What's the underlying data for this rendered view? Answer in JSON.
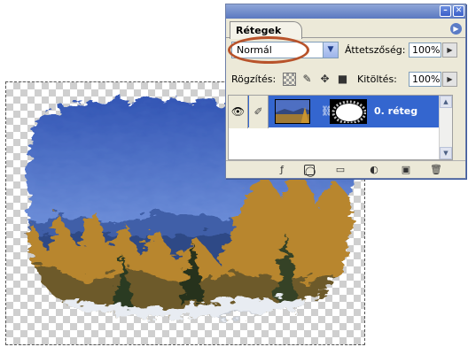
{
  "layers_panel": {
    "tab_label": "Rétegek",
    "blend_mode": "Normál",
    "opacity_label": "Áttetszőség:",
    "opacity_value": "100%",
    "lock_label": "Rögzítés:",
    "fill_label": "Kitöltés:",
    "fill_value": "100%",
    "layers": [
      {
        "name": "0. réteg",
        "visible": true,
        "selected": true
      }
    ]
  },
  "colors": {
    "selection": "#3466cf",
    "panel_bg": "#ece9d8",
    "highlight_ring": "#b8532b"
  },
  "icons": {
    "minimize": "minimize-icon",
    "close": "close-icon",
    "palette_menu": "palette-menu-icon",
    "eye": "eye-icon",
    "brush": "brush-icon",
    "link": "chain-link-icon"
  }
}
